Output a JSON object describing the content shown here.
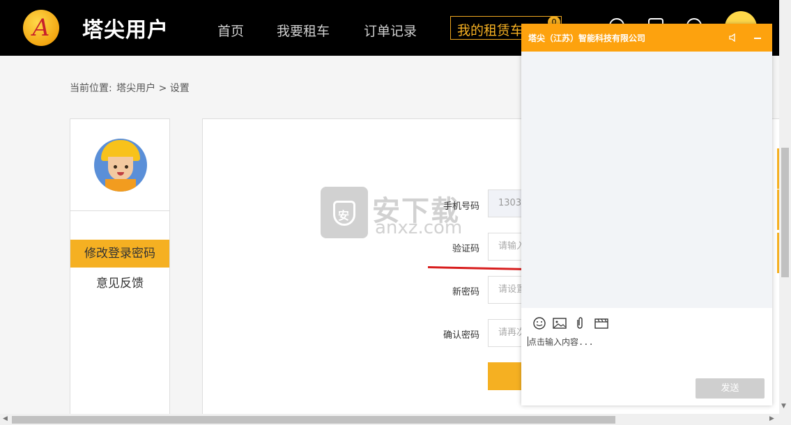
{
  "header": {
    "logo_letter": "A",
    "brand": "塔尖用户",
    "nav": [
      "首页",
      "我要租车",
      "订单记录"
    ],
    "lease_label": "我的租赁车",
    "cart_count": "0",
    "accent_color": "#f5b022"
  },
  "breadcrumb": {
    "label": "当前位置:",
    "path": "塔尖用户 > 设置"
  },
  "sidebar": {
    "items": [
      {
        "label": "修改登录密码",
        "active": true
      },
      {
        "label": "意见反馈",
        "active": false
      }
    ]
  },
  "form": {
    "fields": [
      {
        "label": "手机号码",
        "value": "1303",
        "placeholder": ""
      },
      {
        "label": "验证码",
        "value": "",
        "placeholder": "请输入"
      },
      {
        "label": "新密码",
        "value": "",
        "placeholder": "请设置"
      },
      {
        "label": "确认密码",
        "value": "",
        "placeholder": "请再次"
      }
    ]
  },
  "watermark": {
    "shield": "安",
    "title": "安下载",
    "subtitle": "anxz.com"
  },
  "chat": {
    "title": "塔尖（江苏）智能科技有限公司",
    "input_placeholder": "点击输入内容...",
    "send_label": "发送",
    "tools": [
      "emoji-icon",
      "image-icon",
      "attachment-icon",
      "video-icon"
    ],
    "header_color": "#fda20e"
  }
}
